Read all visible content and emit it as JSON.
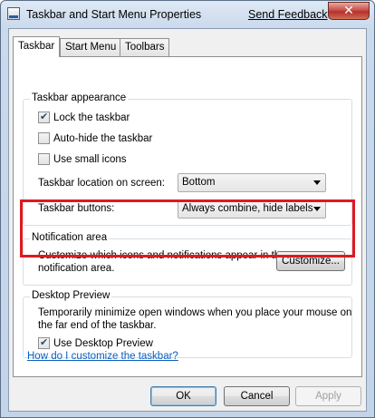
{
  "window": {
    "title": "Taskbar and Start Menu Properties",
    "send_feedback": "Send Feedback",
    "close_glyph": "✕"
  },
  "tabs": [
    {
      "label": "Taskbar",
      "active": true
    },
    {
      "label": "Start Menu",
      "active": false
    },
    {
      "label": "Toolbars",
      "active": false
    }
  ],
  "taskbar_appearance": {
    "heading": "Taskbar appearance",
    "lock": {
      "label": "Lock the taskbar",
      "checked": true
    },
    "auto_hide": {
      "label": "Auto-hide the taskbar",
      "checked": false
    },
    "small_icons": {
      "label": "Use small icons",
      "checked": false
    },
    "location_label": "Taskbar location on screen:",
    "location_value": "Bottom",
    "buttons_label": "Taskbar buttons:",
    "buttons_value": "Always combine, hide labels"
  },
  "notification_area": {
    "heading": "Notification area",
    "description_line1": "Customize which icons and notifications appear in the",
    "description_line2": "notification area.",
    "customize_button": "Customize...",
    "highlight_color": "#e0191f"
  },
  "desktop_preview": {
    "heading": "Desktop Preview",
    "description_line1": "Temporarily minimize open windows when you place your mouse on",
    "description_line2": "the far end of the taskbar.",
    "use_preview": {
      "label": "Use Desktop Preview",
      "checked": true
    }
  },
  "help_link": "How do I customize the taskbar?",
  "footer": {
    "ok": "OK",
    "cancel": "Cancel",
    "apply": "Apply"
  }
}
